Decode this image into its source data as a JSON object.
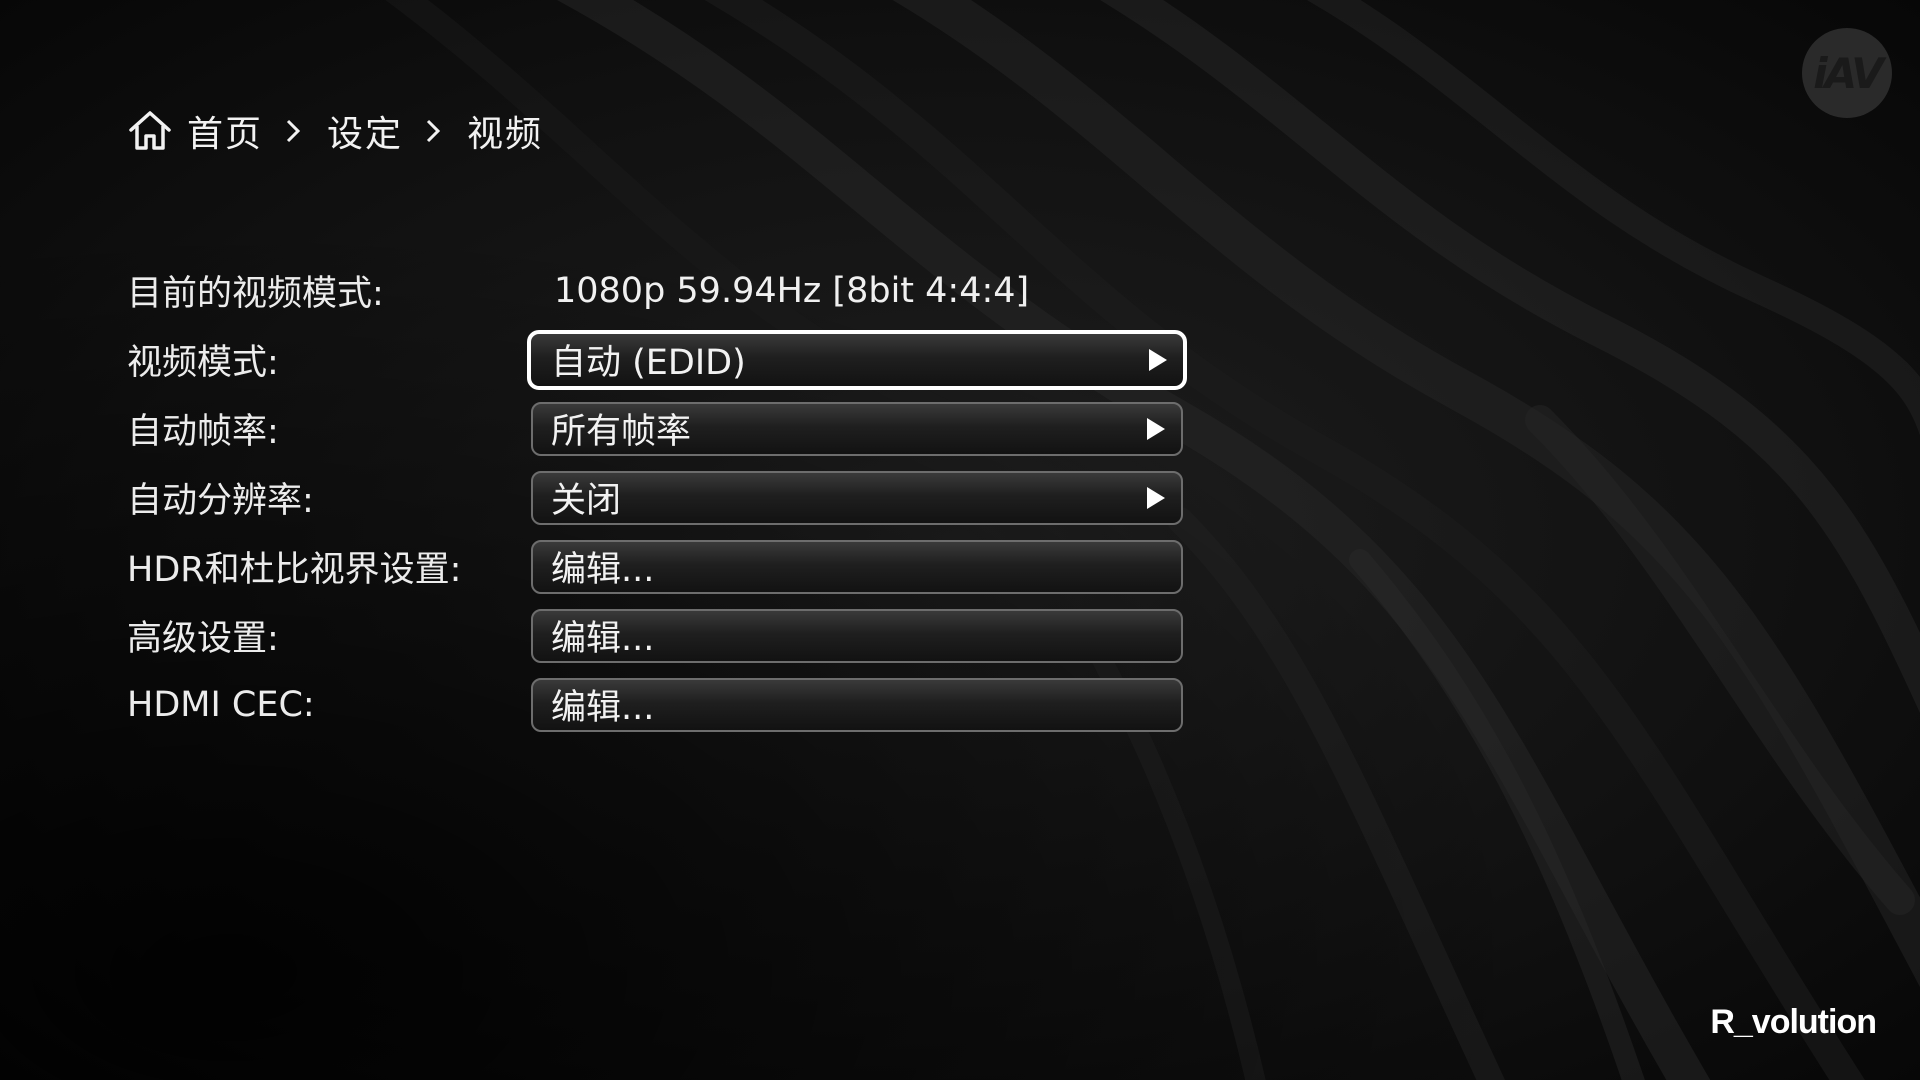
{
  "breadcrumb": {
    "home_icon": "home-icon",
    "separator_icon": "chevron-right-icon",
    "items": [
      "首页",
      "设定",
      "视频"
    ]
  },
  "settings": {
    "current_mode": {
      "label": "目前的视频模式:",
      "value": "1080p 59.94Hz [8bit 4:4:4]"
    },
    "rows": [
      {
        "label": "视频模式:",
        "value": "自动 (EDID)",
        "has_arrow": true,
        "focused": true
      },
      {
        "label": "自动帧率:",
        "value": "所有帧率",
        "has_arrow": true,
        "focused": false
      },
      {
        "label": "自动分辨率:",
        "value": "关闭",
        "has_arrow": true,
        "focused": false
      },
      {
        "label": "HDR和杜比视界设置:",
        "value": "编辑...",
        "has_arrow": false,
        "focused": false
      },
      {
        "label": "高级设置:",
        "value": "编辑...",
        "has_arrow": false,
        "focused": false
      },
      {
        "label": "HDMI CEC:",
        "value": "编辑...",
        "has_arrow": false,
        "focused": false
      }
    ]
  },
  "logos": {
    "corner": "iAV",
    "brand": "R_volution"
  },
  "colors": {
    "background": "#0c0c0c",
    "text": "#f0f0f0",
    "focus_border": "#ffffff",
    "control_border": "#6d6d6d"
  }
}
